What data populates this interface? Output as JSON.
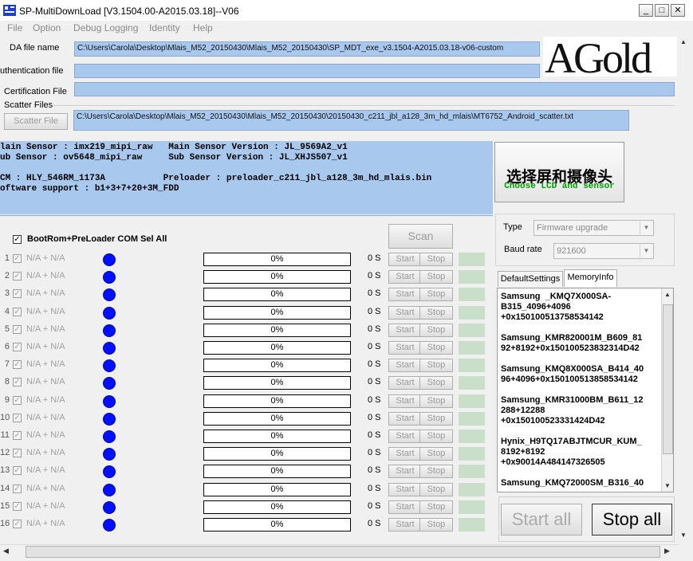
{
  "window": {
    "title": "SP-MultiDownLoad [V3.1504.00-A2015.03.18]--V06",
    "min_label": "_",
    "max_label": "□",
    "close_label": "✕"
  },
  "menu": [
    "File",
    "Option",
    "Debug Logging",
    "Identity",
    "Help"
  ],
  "files": {
    "da_label": "DA file name",
    "da_value": "C:\\Users\\Carola\\Desktop\\Mlais_M52_20150430\\Mlais_M52_20150430\\SP_MDT_exe_v3.1504-A2015.03.18-v06-custom",
    "auth_label": "uthentication file",
    "auth_value": "",
    "cert_label": "Certification File",
    "cert_value": "",
    "scatter_group": "Scatter Files",
    "scatter_button": "Scatter File",
    "scatter_value": "C:\\Users\\Carola\\Desktop\\Mlais_M52_20150430\\Mlais_M52_20150430\\20150430_c211_jbl_a128_3m_hd_mlais\\MT6752_Android_scatter.txt"
  },
  "logo": "AGold",
  "info": {
    "line1": "lain Sensor : imx219_mipi_raw   Main Sensor Version : JL_9569A2_v1",
    "line2": "ub Sensor : ov5648_mipi_raw     Sub Sensor Version : JL_XHJS507_v1",
    "line3": "CM : HLY_546RM_1173A           Preloader : preloader_c211_jbl_a128_3m_hd_mlais.bin",
    "line4": "oftware support : b1+3+7+20+3M_FDD"
  },
  "choose": {
    "cn": "选择屏和摄像头",
    "en": "Choose LCD and sensor"
  },
  "com_sel": {
    "label": "BootRom+PreLoader COM Sel All",
    "checked": true
  },
  "scan_label": "Scan",
  "slots": [
    {
      "num": "1",
      "label": "N/A + N/A",
      "progress": "0%",
      "time": "0 S",
      "start": "Start",
      "stop": "Stop"
    },
    {
      "num": "2",
      "label": "N/A + N/A",
      "progress": "0%",
      "time": "0 S",
      "start": "Start",
      "stop": "Stop"
    },
    {
      "num": "3",
      "label": "N/A + N/A",
      "progress": "0%",
      "time": "0 S",
      "start": "Start",
      "stop": "Stop"
    },
    {
      "num": "4",
      "label": "N/A + N/A",
      "progress": "0%",
      "time": "0 S",
      "start": "Start",
      "stop": "Stop"
    },
    {
      "num": "5",
      "label": "N/A + N/A",
      "progress": "0%",
      "time": "0 S",
      "start": "Start",
      "stop": "Stop"
    },
    {
      "num": "6",
      "label": "N/A + N/A",
      "progress": "0%",
      "time": "0 S",
      "start": "Start",
      "stop": "Stop"
    },
    {
      "num": "7",
      "label": "N/A + N/A",
      "progress": "0%",
      "time": "0 S",
      "start": "Start",
      "stop": "Stop"
    },
    {
      "num": "8",
      "label": "N/A + N/A",
      "progress": "0%",
      "time": "0 S",
      "start": "Start",
      "stop": "Stop"
    },
    {
      "num": "9",
      "label": "N/A + N/A",
      "progress": "0%",
      "time": "0 S",
      "start": "Start",
      "stop": "Stop"
    },
    {
      "num": "10",
      "label": "N/A + N/A",
      "progress": "0%",
      "time": "0 S",
      "start": "Start",
      "stop": "Stop"
    },
    {
      "num": "11",
      "label": "N/A + N/A",
      "progress": "0%",
      "time": "0 S",
      "start": "Start",
      "stop": "Stop"
    },
    {
      "num": "12",
      "label": "N/A + N/A",
      "progress": "0%",
      "time": "0 S",
      "start": "Start",
      "stop": "Stop"
    },
    {
      "num": "13",
      "label": "N/A + N/A",
      "progress": "0%",
      "time": "0 S",
      "start": "Start",
      "stop": "Stop"
    },
    {
      "num": "14",
      "label": "N/A + N/A",
      "progress": "0%",
      "time": "0 S",
      "start": "Start",
      "stop": "Stop"
    },
    {
      "num": "15",
      "label": "N/A + N/A",
      "progress": "0%",
      "time": "0 S",
      "start": "Start",
      "stop": "Stop"
    },
    {
      "num": "16",
      "label": "N/A + N/A",
      "progress": "0%",
      "time": "0 S",
      "start": "Start",
      "stop": "Stop"
    }
  ],
  "settings": {
    "type_label": "Type",
    "type_value": "Firmware upgrade",
    "baud_label": "Baud rate",
    "baud_value": "921600"
  },
  "tabs": [
    {
      "label": "DefaultSettings",
      "active": false
    },
    {
      "label": "MemoryInfo",
      "active": true
    }
  ],
  "memory": [
    "Samsung  _KMQ7X000SA-\nB315_4096+4096\n+0x150100513758534142",
    "Samsung_KMR820001M_B609_81\n92+8192+0x150100523832314D42",
    "Samsung_KMQ8X000SA_B414_40\n96+4096+0x150100513858534142",
    "Samsung_KMR31000BM_B611_12\n288+12288\n+0x150100523331424D42",
    "Hynix_H9TQ17ABJTMCUR_KUM_\n8192+8192\n+0x90014A484147326505",
    "Samsung_KMQ72000SM_B316_40"
  ],
  "start_all": "Start all",
  "stop_all": "Stop all",
  "colors": {
    "field_bg": "#a8c8ee",
    "dot": "#0010ff",
    "status": "#c9dfc9",
    "chinese_green": "#00a000"
  }
}
